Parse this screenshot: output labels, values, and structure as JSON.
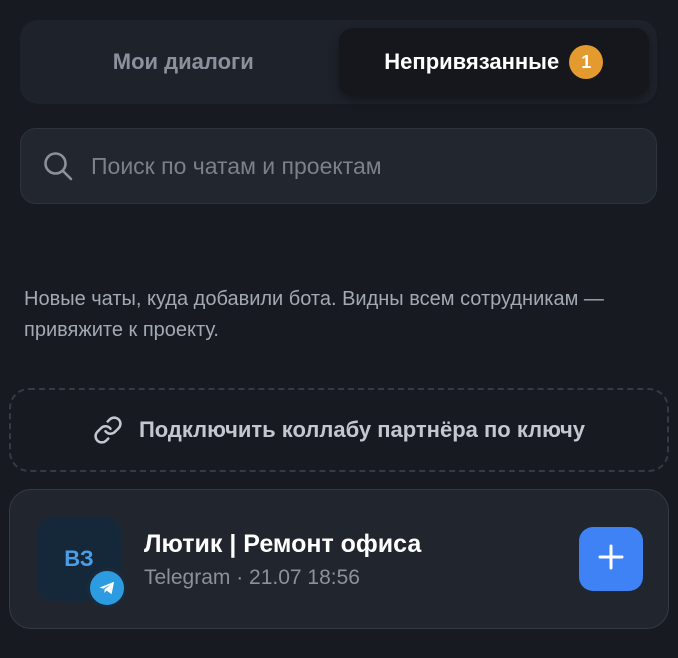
{
  "tabs": {
    "my_dialogs": "Мои диалоги",
    "unlinked": "Непривязанные",
    "unlinked_count": "1"
  },
  "search": {
    "placeholder": "Поиск по чатам и проектам",
    "value": ""
  },
  "description": "Новые чаты, куда добавили бота. Видны всем сотрудникам — привяжите к проекту.",
  "connect": {
    "label": "Подключить коллабу партнёра по ключу",
    "icon": "link-icon"
  },
  "chat": {
    "initials": "ВЗ",
    "title": "Лютик | Ремонт офиса",
    "subtitle": "Telegram · 21.07 18:56",
    "platform_icon": "telegram-icon",
    "action_icon": "plus-icon"
  },
  "colors": {
    "background": "#171a21",
    "badge": "#e39a2f",
    "accent": "#3f82f6",
    "telegram": "#2d9be0"
  }
}
